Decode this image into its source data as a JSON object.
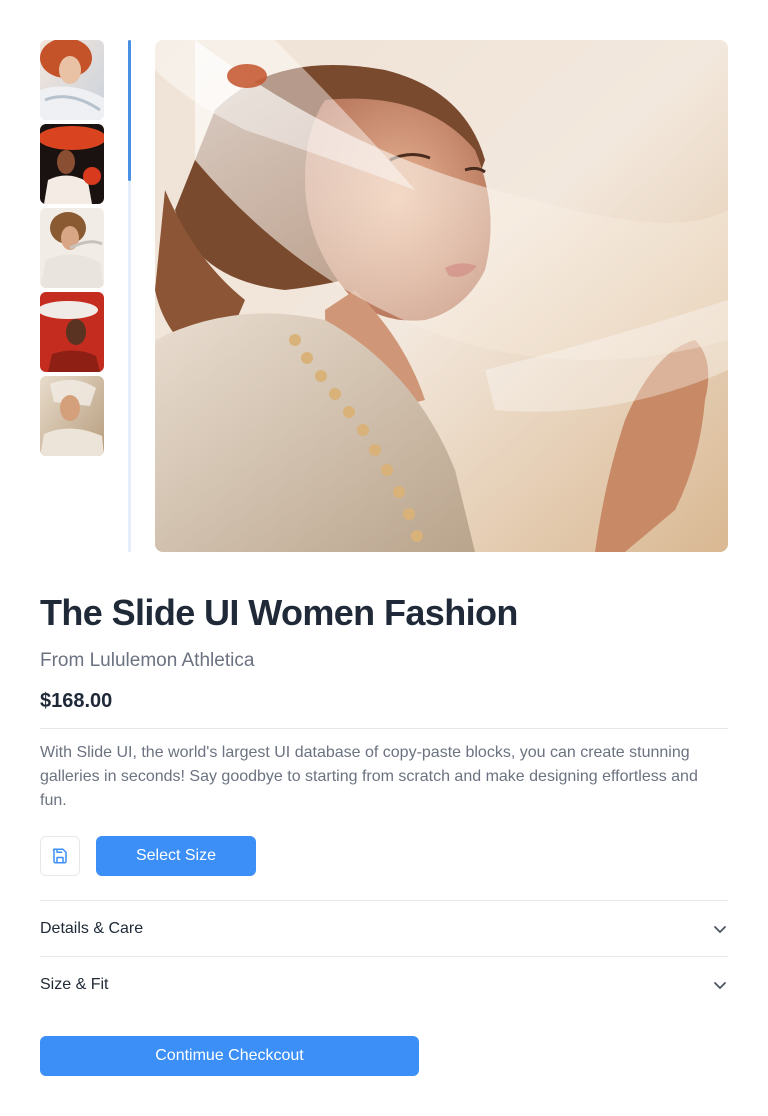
{
  "gallery": {
    "thumbnails": [
      {
        "alt": "woman with red hair in white flowing fabric"
      },
      {
        "alt": "woman in red wide-brim hat"
      },
      {
        "alt": "woman with curly hair and white scarf"
      },
      {
        "alt": "woman in red hat against red background"
      },
      {
        "alt": "woman with veil in soft light"
      }
    ],
    "main_image_alt": "woman with closed eyes wrapped in sheer white veil"
  },
  "product": {
    "title": "The Slide UI Women Fashion",
    "brand": "From Lululemon Athletica",
    "price": "$168.00",
    "description": "With Slide UI, the world's largest UI database of copy-paste blocks, you can create stunning galleries in seconds! Say goodbye to starting from scratch and make designing effortless and fun."
  },
  "actions": {
    "save_icon": "save-icon",
    "select_size_label": "Select Size",
    "checkout_label": "Contimue Checkcout"
  },
  "accordions": [
    {
      "label": "Details & Care",
      "icon": "chevron-down-icon"
    },
    {
      "label": "Size & Fit",
      "icon": "chevron-down-icon"
    }
  ],
  "colors": {
    "accent": "#3b8ff6",
    "track_fill": "#4a90e2",
    "text_primary": "#1f2937",
    "text_secondary": "#6b7280"
  }
}
